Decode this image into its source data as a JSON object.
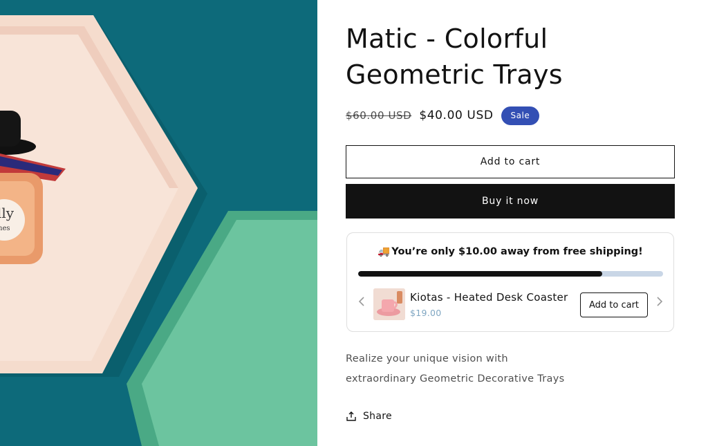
{
  "product": {
    "title": "Matic - Colorful Geometric Trays",
    "price_regular": "$60.00 USD",
    "price_sale": "$40.00 USD",
    "badge": "Sale",
    "add_to_cart_label": "Add to cart",
    "buy_now_label": "Buy it now",
    "description_lines": [
      "Realize your unique vision with",
      "extraordinary Geometric Decorative Trays"
    ],
    "share_label": "Share"
  },
  "shipping_bar": {
    "truck_icon": "🚚",
    "message": "You’re only $10.00 away from free shipping!",
    "progress": 0.8,
    "fill_color": "#121212",
    "track_color": "#c9d6e6"
  },
  "upsell": {
    "name": "Kiotas - Heated Desk Coaster",
    "price": "$19.00",
    "add_label": "Add to cart",
    "prev_icon": "chevron-left-icon",
    "next_icon": "chevron-right-icon"
  },
  "colors": {
    "sale_badge": "#334fb4",
    "primary_button": "#121212",
    "image_background": "#0d6a7a"
  }
}
